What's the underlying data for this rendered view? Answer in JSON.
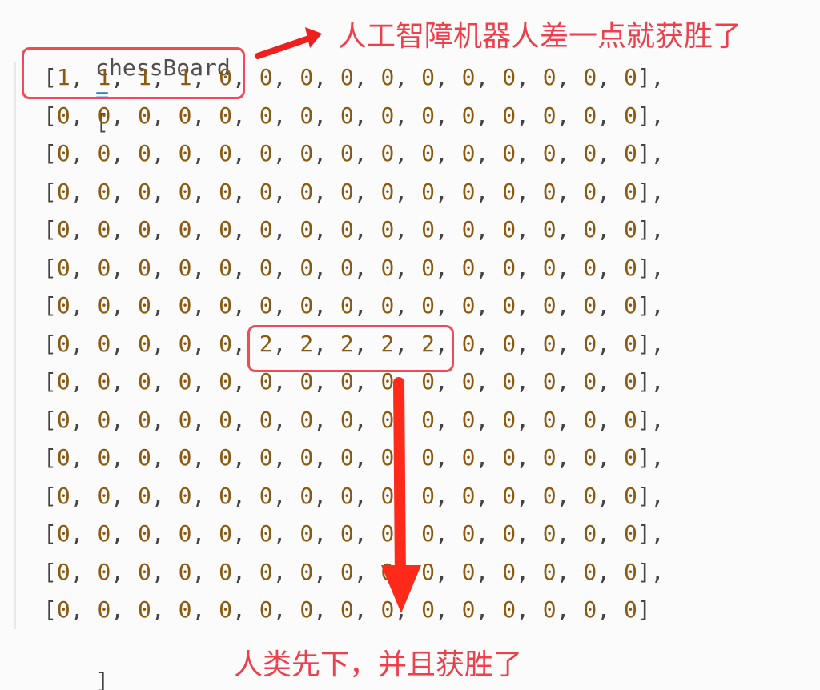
{
  "code": {
    "header": {
      "identifier": "chessBoard",
      "operator": "=",
      "open_bracket": "["
    },
    "rows": [
      [
        "1",
        "1",
        "1",
        "1",
        "0",
        "0",
        "0",
        "0",
        "0",
        "0",
        "0",
        "0",
        "0",
        "0",
        "0"
      ],
      [
        "0",
        "0",
        "0",
        "0",
        "0",
        "0",
        "0",
        "0",
        "0",
        "0",
        "0",
        "0",
        "0",
        "0",
        "0"
      ],
      [
        "0",
        "0",
        "0",
        "0",
        "0",
        "0",
        "0",
        "0",
        "0",
        "0",
        "0",
        "0",
        "0",
        "0",
        "0"
      ],
      [
        "0",
        "0",
        "0",
        "0",
        "0",
        "0",
        "0",
        "0",
        "0",
        "0",
        "0",
        "0",
        "0",
        "0",
        "0"
      ],
      [
        "0",
        "0",
        "0",
        "0",
        "0",
        "0",
        "0",
        "0",
        "0",
        "0",
        "0",
        "0",
        "0",
        "0",
        "0"
      ],
      [
        "0",
        "0",
        "0",
        "0",
        "0",
        "0",
        "0",
        "0",
        "0",
        "0",
        "0",
        "0",
        "0",
        "0",
        "0"
      ],
      [
        "0",
        "0",
        "0",
        "0",
        "0",
        "0",
        "0",
        "0",
        "0",
        "0",
        "0",
        "0",
        "0",
        "0",
        "0"
      ],
      [
        "0",
        "0",
        "0",
        "0",
        "0",
        "2",
        "2",
        "2",
        "2",
        "2",
        "0",
        "0",
        "0",
        "0",
        "0"
      ],
      [
        "0",
        "0",
        "0",
        "0",
        "0",
        "0",
        "0",
        "0",
        "0",
        "0",
        "0",
        "0",
        "0",
        "0",
        "0"
      ],
      [
        "0",
        "0",
        "0",
        "0",
        "0",
        "0",
        "0",
        "0",
        "0",
        "0",
        "0",
        "0",
        "0",
        "0",
        "0"
      ],
      [
        "0",
        "0",
        "0",
        "0",
        "0",
        "0",
        "0",
        "0",
        "0",
        "0",
        "0",
        "0",
        "0",
        "0",
        "0"
      ],
      [
        "0",
        "0",
        "0",
        "0",
        "0",
        "0",
        "0",
        "0",
        "0",
        "0",
        "0",
        "0",
        "0",
        "0",
        "0"
      ],
      [
        "0",
        "0",
        "0",
        "0",
        "0",
        "0",
        "0",
        "0",
        "0",
        "0",
        "0",
        "0",
        "0",
        "0",
        "0"
      ],
      [
        "0",
        "0",
        "0",
        "0",
        "0",
        "0",
        "0",
        "0",
        "0",
        "0",
        "0",
        "0",
        "0",
        "0",
        "0"
      ],
      [
        "0",
        "0",
        "0",
        "0",
        "0",
        "0",
        "0",
        "0",
        "0",
        "0",
        "0",
        "0",
        "0",
        "0",
        "0"
      ]
    ],
    "close_bracket": "]"
  },
  "annotations": {
    "top_text": "人工智障机器人差一点就获胜了",
    "bottom_text": "人类先下，并且获胜了"
  },
  "colors": {
    "annotation_red": "#ef3f4a",
    "number_brown": "#8a5a12",
    "operator_blue": "#2f78c9"
  }
}
